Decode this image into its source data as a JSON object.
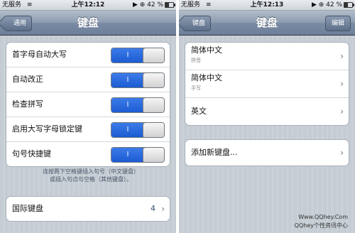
{
  "left": {
    "status": {
      "carrier": "无服务",
      "time": "上午12:12",
      "battery": "42 %"
    },
    "nav": {
      "back_label": "通用",
      "title": "键盘"
    },
    "toggles": [
      {
        "label": "首字母自动大写",
        "state": "I"
      },
      {
        "label": "自动改正",
        "state": "I"
      },
      {
        "label": "检查拼写",
        "state": "I"
      },
      {
        "label": "启用大写字母锁定键",
        "state": "I"
      },
      {
        "label": "句号快捷键",
        "state": "I"
      }
    ],
    "footnote_line1": "连按两下空格键插入句号（中文键盘）",
    "footnote_line2": "或插入句点与空格（其他键盘）。",
    "international": {
      "label": "国际键盘",
      "count": "4"
    }
  },
  "right": {
    "status": {
      "carrier": "无服务",
      "time": "上午12:13",
      "battery": "42 %"
    },
    "nav": {
      "back_label": "键盘",
      "title": "键盘",
      "edit_label": "编辑"
    },
    "keyboards": [
      {
        "label": "简体中文",
        "sub": "拼音"
      },
      {
        "label": "简体中文",
        "sub": "手写"
      },
      {
        "label": "英文",
        "sub": ""
      }
    ],
    "add_label": "添加新键盘..."
  },
  "watermark": {
    "line1": "Www.QQhey.Com",
    "line2": "QQhey个性资讯中心"
  }
}
